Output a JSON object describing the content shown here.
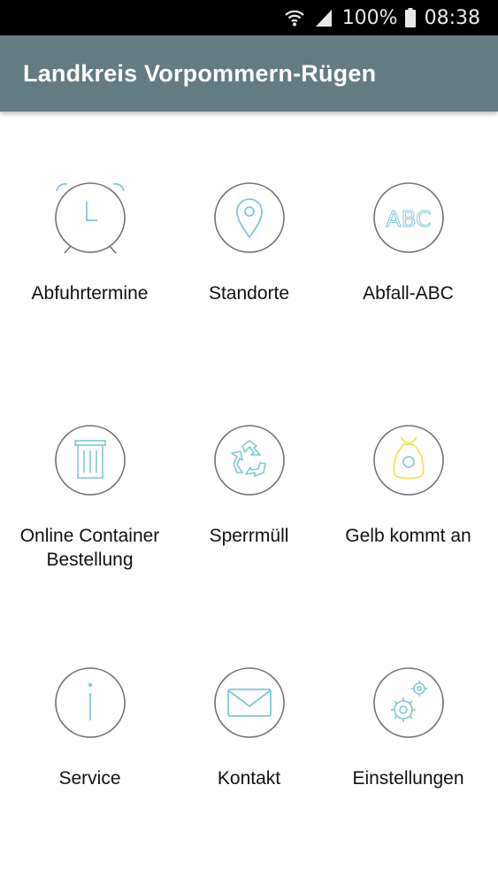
{
  "status_bar": {
    "battery": "100%",
    "time": "08:38"
  },
  "app_bar": {
    "title": "Landkreis Vorpommern-Rügen"
  },
  "colors": {
    "app_bar": "#637b82",
    "icon_circle": "#707070",
    "icon_accent": "#7fc8d6",
    "icon_yellow": "#f2e25a"
  },
  "menu": [
    {
      "label": "Abfuhrtermine",
      "icon": "alarm-clock-icon"
    },
    {
      "label": "Standorte",
      "icon": "map-pin-icon"
    },
    {
      "label": "Abfall-ABC",
      "icon": "abc-icon"
    },
    {
      "label": "Online Container\nBestellung",
      "icon": "trash-bin-icon"
    },
    {
      "label": "Sperrmüll",
      "icon": "recycle-icon"
    },
    {
      "label": "Gelb kommt an",
      "icon": "yellow-bag-icon"
    },
    {
      "label": "Service",
      "icon": "info-icon"
    },
    {
      "label": "Kontakt",
      "icon": "mail-icon"
    },
    {
      "label": "Einstellungen",
      "icon": "gears-icon"
    }
  ]
}
